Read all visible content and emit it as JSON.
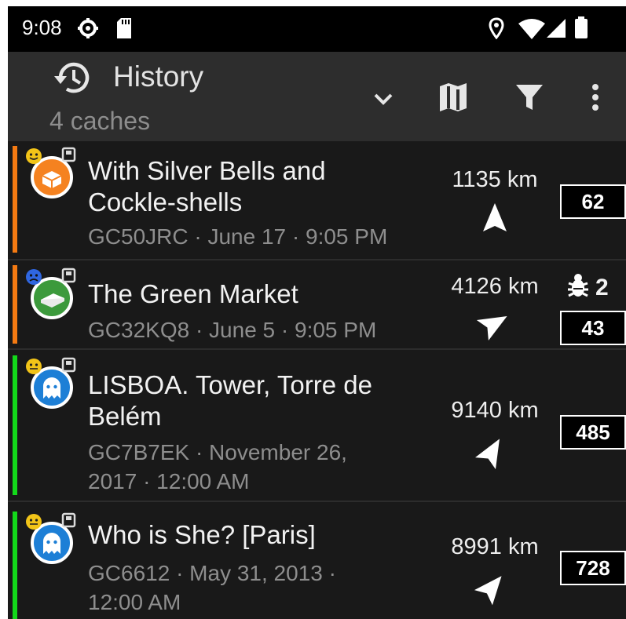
{
  "status_bar": {
    "time": "9:08",
    "icons": [
      "gear-icon",
      "sd-card-icon",
      "location-pin-icon",
      "wifi-icon",
      "cell-signal-icon",
      "battery-icon"
    ]
  },
  "action_bar": {
    "title": "History",
    "subtitle": "4 caches",
    "icons": [
      "history-icon",
      "chevron-down-icon",
      "map-icon",
      "filter-icon",
      "more-vert-icon"
    ]
  },
  "colors": {
    "orange": "#f47a12",
    "green": "#13d91a",
    "cache_orange": "#f58220",
    "cache_green": "#3c9a3c",
    "cache_blue": "#1d7fd6",
    "smiley_yellow": "#f2c418",
    "smiley_blue": "#2f66e0"
  },
  "caches": [
    {
      "title_line1": "With Silver Bells and",
      "title_line2": "Cockle-shells",
      "meta_line1": "GC50JRC · June 17 · 9:05 PM",
      "meta_line2": "",
      "distance": "1135 km",
      "count": "62",
      "trackables": "",
      "icon": "box-cache-icon",
      "bar_color": "orange",
      "arrow_rotation_deg": 0
    },
    {
      "title_line1": "The Green Market",
      "title_line2": "",
      "meta_line1": "GC32KQ8 · June 5 · 9:05 PM",
      "meta_line2": "",
      "distance": "4126 km",
      "count": "43",
      "trackables": "2",
      "icon": "letterbox-cache-icon",
      "bar_color": "orange",
      "arrow_rotation_deg": 60
    },
    {
      "title_line1": "LISBOA. Tower, Torre de",
      "title_line2": "Belém",
      "meta_line1": "GC7B7EK · November 26,",
      "meta_line2": "2017 · 12:00 AM",
      "distance": "9140 km",
      "count": "485",
      "trackables": "",
      "icon": "ghost-cache-icon",
      "bar_color": "green",
      "arrow_rotation_deg": 30
    },
    {
      "title_line1": "Who is She? [Paris]",
      "title_line2": "",
      "meta_line1": "GC6612 · May 31, 2013 ·",
      "meta_line2": "12:00 AM",
      "distance": "8991 km",
      "count": "728",
      "trackables": "",
      "icon": "ghost-cache-icon",
      "bar_color": "green",
      "arrow_rotation_deg": 40
    }
  ]
}
